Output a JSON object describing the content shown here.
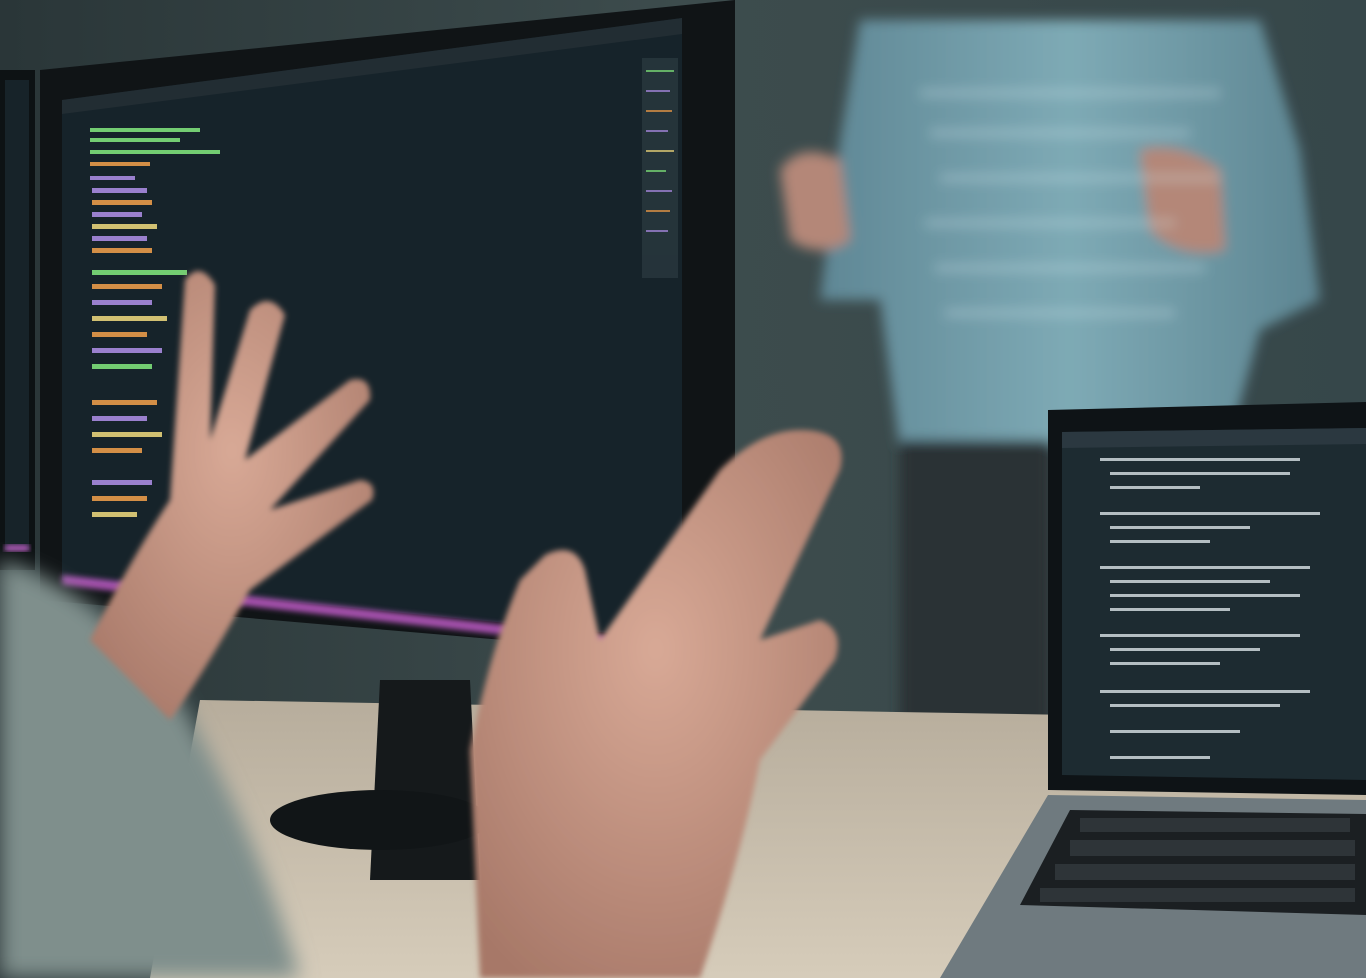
{
  "image": {
    "subject": "developer-workspace-photo",
    "palette": {
      "background": "#2c3a3d",
      "wall": "#3b4a4c",
      "desk": "#c9bfae",
      "monitor_bezel": "#101416",
      "monitor_screen": "#16232a",
      "accent_glow": "#c05cc8",
      "code_green": "#7ee07a",
      "code_orange": "#e89a4a",
      "code_purple": "#a98be0",
      "code_yellow": "#e6d27a",
      "shirt": "#6e9aa6",
      "skin": "#b88a7a",
      "laptop_body": "#6f7a7f",
      "laptop_screen": "#1d2b31",
      "keyboard": "#1b1f22"
    }
  }
}
